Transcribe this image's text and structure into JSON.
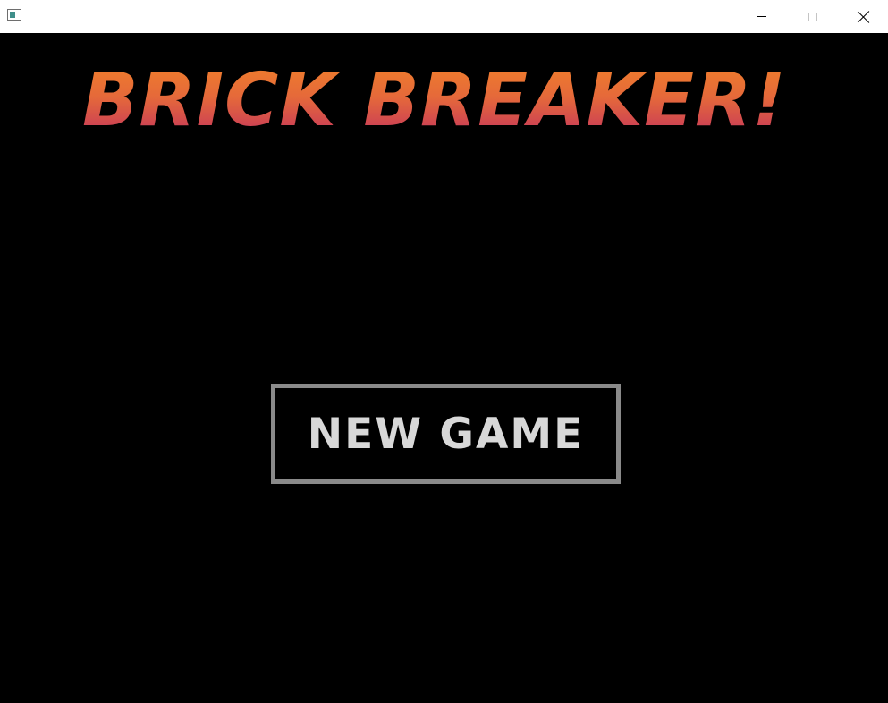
{
  "window": {
    "icon": "app-window-icon",
    "controls": {
      "minimize_icon": "minimize-icon",
      "maximize_icon": "maximize-icon",
      "close_icon": "close-icon"
    }
  },
  "game": {
    "title": "BRICK BREAKER!",
    "title_colors": [
      "#f0802a",
      "#c2305f"
    ],
    "new_game_label": "NEW GAME",
    "background_color": "#000000",
    "button_border_color": "#8a8a8a",
    "button_text_color": "#d8d8d8"
  }
}
